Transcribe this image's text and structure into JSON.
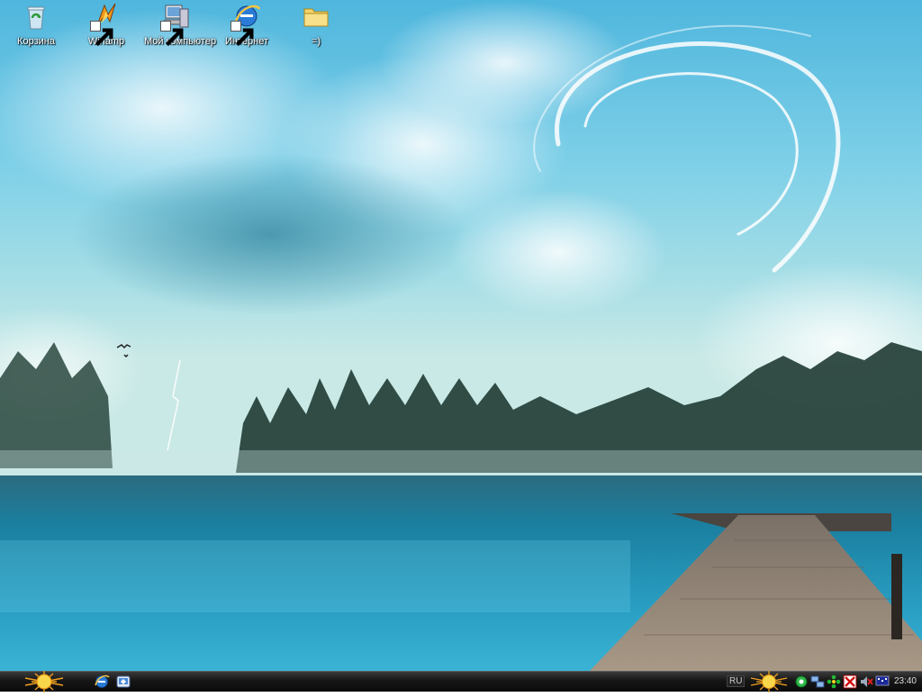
{
  "desktop": {
    "icons": [
      {
        "label": "Корзина",
        "icon": "recycle-bin-icon"
      },
      {
        "label": "Winamp",
        "icon": "winamp-icon"
      },
      {
        "label": "Мой компьютер",
        "icon": "my-computer-icon"
      },
      {
        "label": "Интернет",
        "icon": "internet-explorer-icon"
      },
      {
        "label": "=)",
        "icon": "folder-icon"
      }
    ],
    "wallpaper": "lake-pier-storm"
  },
  "taskbar": {
    "start_icon": "sun-logo-icon",
    "quick_launch": [
      "internet-explorer-icon",
      "show-desktop-icon"
    ],
    "language": "RU",
    "tray_icons": [
      "sun-logo-icon",
      "icq-icon",
      "network-icon",
      "icq-flower-icon",
      "antivirus-icon",
      "volume-icon",
      "monitor-icon"
    ],
    "clock": "23:40"
  },
  "colors": {
    "sky": "#6fc7e3",
    "water": "#1f8fb0",
    "taskbar": "#161616",
    "accent_sun": "#f0c020"
  }
}
